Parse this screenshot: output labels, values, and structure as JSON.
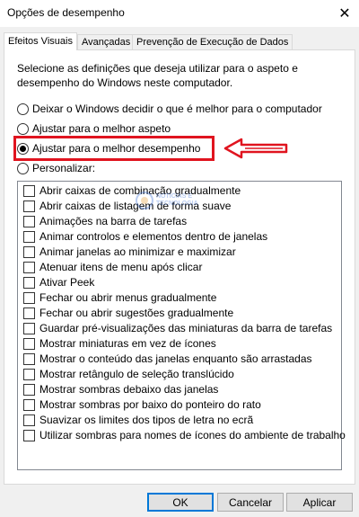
{
  "window": {
    "title": "Opções de desempenho",
    "close_glyph": "✕"
  },
  "tabs": [
    {
      "label": "Efeitos Visuais",
      "active": true
    },
    {
      "label": "Avançadas",
      "active": false
    },
    {
      "label": "Prevenção de Execução de Dados",
      "active": false
    }
  ],
  "description": "Selecione as definições que deseja utilizar para o aspeto e desempenho do Windows neste computador.",
  "radios": [
    {
      "label": "Deixar o Windows decidir o que é melhor para o computador",
      "selected": false
    },
    {
      "label": "Ajustar para o melhor aspeto",
      "selected": false
    },
    {
      "label": "Ajustar para o melhor desempenho",
      "selected": true
    },
    {
      "label": "Personalizar:",
      "selected": false
    }
  ],
  "effects": [
    {
      "label": "Abrir caixas de combinação gradualmente",
      "checked": false
    },
    {
      "label": "Abrir caixas de listagem de forma suave",
      "checked": false
    },
    {
      "label": "Animações na barra de tarefas",
      "checked": false
    },
    {
      "label": "Animar controlos e elementos dentro de janelas",
      "checked": false
    },
    {
      "label": "Animar janelas ao minimizar e maximizar",
      "checked": false
    },
    {
      "label": "Atenuar itens de menu após clicar",
      "checked": false
    },
    {
      "label": "Ativar Peek",
      "checked": false
    },
    {
      "label": "Fechar ou abrir menus gradualmente",
      "checked": false
    },
    {
      "label": "Fechar ou abrir sugestões gradualmente",
      "checked": false
    },
    {
      "label": "Guardar pré-visualizações das miniaturas da barra de tarefas",
      "checked": false
    },
    {
      "label": "Mostrar miniaturas em vez de ícones",
      "checked": false
    },
    {
      "label": "Mostrar o conteúdo das janelas enquanto são arrastadas",
      "checked": false
    },
    {
      "label": "Mostrar retângulo de seleção translúcido",
      "checked": false
    },
    {
      "label": "Mostrar sombras debaixo das janelas",
      "checked": false
    },
    {
      "label": "Mostrar sombras por baixo do ponteiro do rato",
      "checked": false
    },
    {
      "label": "Suavizar os limites dos tipos de letra no ecrã",
      "checked": false
    },
    {
      "label": "Utilizar sombras para nomes de ícones do ambiente de trabalho",
      "checked": false
    }
  ],
  "watermark": {
    "line1": "NOTÍCIAS E",
    "line2": "TECNOLOGIA"
  },
  "buttons": {
    "ok": "OK",
    "cancel": "Cancelar",
    "apply": "Aplicar"
  },
  "colors": {
    "highlight": "#e0141f",
    "accent": "#0078d7"
  }
}
